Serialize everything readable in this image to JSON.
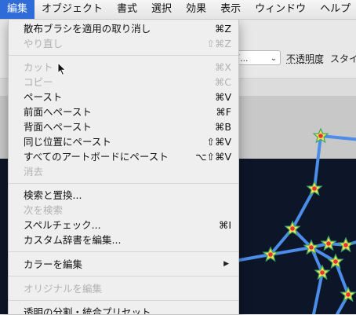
{
  "menubar": {
    "items": [
      {
        "label": "編集",
        "active": true
      },
      {
        "label": "オブジェクト"
      },
      {
        "label": "書式"
      },
      {
        "label": "選択"
      },
      {
        "label": "効果"
      },
      {
        "label": "表示"
      },
      {
        "label": "ウィンドウ"
      },
      {
        "label": "ヘルプ"
      }
    ]
  },
  "controlbar": {
    "dropdown_value": "ブ...",
    "opacity_label": "不透明度",
    "style_label": "スタイ"
  },
  "edit_menu": {
    "items": [
      {
        "label": "散布ブラシを適用の取り消し",
        "shortcut": "⌘Z",
        "enabled": true
      },
      {
        "label": "やり直し",
        "shortcut": "⇧⌘Z",
        "enabled": false
      },
      {
        "label": "カット",
        "shortcut": "⌘X",
        "enabled": false
      },
      {
        "label": "コピー",
        "shortcut": "⌘C",
        "enabled": false
      },
      {
        "label": "ペースト",
        "shortcut": "⌘V",
        "enabled": true
      },
      {
        "label": "前面へペースト",
        "shortcut": "⌘F",
        "enabled": true
      },
      {
        "label": "背面へペースト",
        "shortcut": "⌘B",
        "enabled": true
      },
      {
        "label": "同じ位置にペースト",
        "shortcut": "⇧⌘V",
        "enabled": true
      },
      {
        "label": "すべてのアートボードにペースト",
        "shortcut": "⌥⇧⌘V",
        "enabled": true
      },
      {
        "label": "消去",
        "shortcut": "",
        "enabled": false
      },
      {
        "label": "検索と置換...",
        "shortcut": "",
        "enabled": true
      },
      {
        "label": "次を検索",
        "shortcut": "",
        "enabled": false
      },
      {
        "label": "スペルチェック...",
        "shortcut": "⌘I",
        "enabled": true
      },
      {
        "label": "カスタム辞書を編集...",
        "shortcut": "",
        "enabled": true
      },
      {
        "label": "カラーを編集",
        "shortcut": "",
        "enabled": true,
        "submenu": true
      },
      {
        "label": "オリジナルを編集",
        "shortcut": "",
        "enabled": false
      },
      {
        "label": "透明の分割・統合プリセット...",
        "shortcut": "",
        "enabled": true
      }
    ]
  },
  "colors": {
    "menu_highlight": "#2f6cd8",
    "artboard_bg": "#0d1628",
    "constellation_line": "#4b8de8",
    "star_outer": "#f5e24a",
    "star_inner": "#e3343a"
  }
}
